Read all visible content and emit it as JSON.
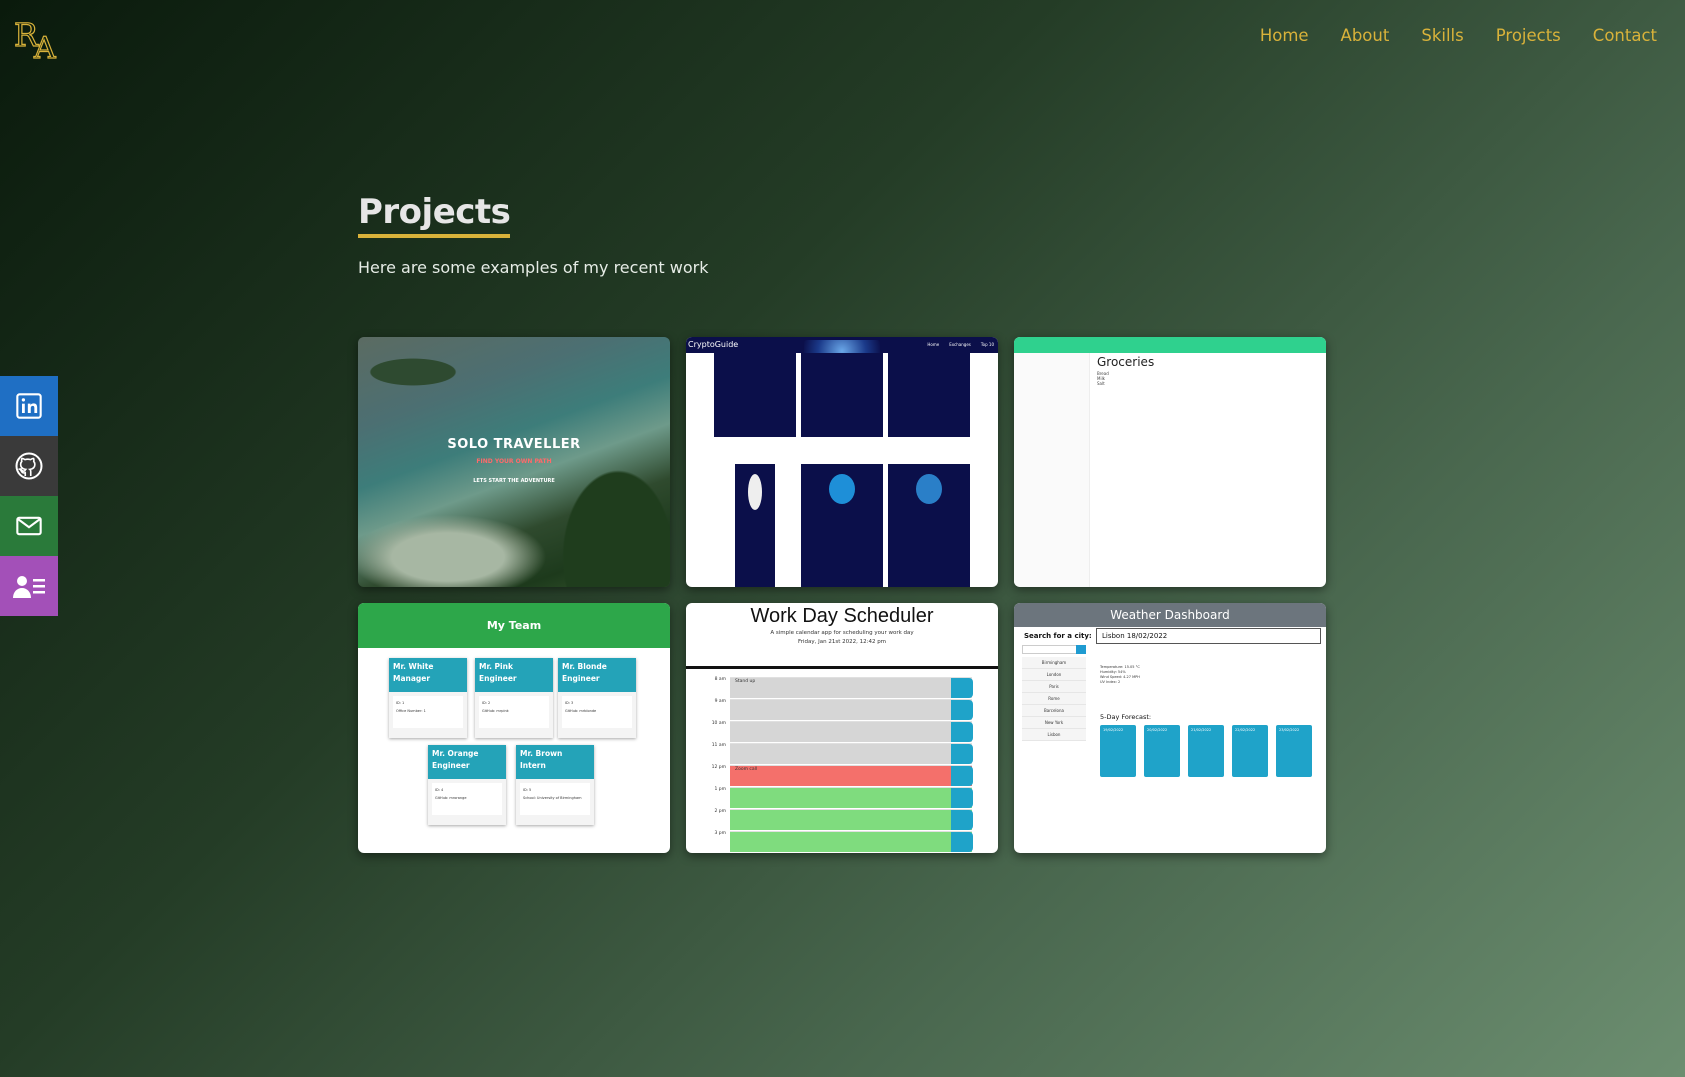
{
  "logo": {
    "text": "RA",
    "color": "#d9b23a"
  },
  "nav": {
    "items": [
      "Home",
      "About",
      "Skills",
      "Projects",
      "Contact"
    ],
    "color": "#d9b23a"
  },
  "social": [
    {
      "icon": "linkedin-icon",
      "color": "#1f6fc4"
    },
    {
      "icon": "github-icon",
      "color": "#3a3a3a"
    },
    {
      "icon": "mail-icon",
      "color": "#2a7a3a"
    },
    {
      "icon": "resume-icon",
      "color": "#a350b8"
    }
  ],
  "page": {
    "title": "Projects",
    "subtitle": "Here are some examples of my recent work"
  },
  "projects": {
    "solo": {
      "title": "SOLO TRAVELLER",
      "tagline": "FIND YOUR OWN PATH",
      "cta": "LETS START THE ADVENTURE"
    },
    "crypto": {
      "brand": "CryptoGuide",
      "nav": [
        "Home",
        "Exchanges",
        "Top 10"
      ]
    },
    "groceries": {
      "title": "Groceries",
      "items": [
        "Bread",
        "Milk",
        "Salt"
      ]
    },
    "team": {
      "title": "My Team",
      "members": [
        {
          "name": "Mr. White",
          "role": "Manager",
          "id": "ID: 1",
          "line": "Office Number: 1"
        },
        {
          "name": "Mr. Pink",
          "role": "Engineer",
          "id": "ID: 2",
          "line": "GitHub: mrpink"
        },
        {
          "name": "Mr. Blonde",
          "role": "Engineer",
          "id": "ID: 3",
          "line": "GitHub: mrblonde"
        },
        {
          "name": "Mr. Orange",
          "role": "Engineer",
          "id": "ID: 4",
          "line": "GitHub: mrorange"
        },
        {
          "name": "Mr. Brown",
          "role": "Intern",
          "id": "ID: 5",
          "line": "School: University of Birmingham"
        }
      ]
    },
    "scheduler": {
      "title": "Work Day Scheduler",
      "subtitle": "A simple calendar app for scheduling your work day",
      "date": "Friday, Jan 21st 2022, 12:42 pm",
      "hours": [
        "8 am",
        "9 am",
        "10 am",
        "11 am",
        "12 pm",
        "1 pm",
        "2 pm",
        "3 pm"
      ],
      "events": {
        "e1": "Stand up",
        "e2": "Zoom call"
      }
    },
    "weather": {
      "title": "Weather Dashboard",
      "search_label": "Search for a city:",
      "search_value": "Lisbon",
      "cities": [
        "Birmingham",
        "London",
        "Paris",
        "Rome",
        "Barcelona",
        "New York",
        "Lisbon"
      ],
      "current": "Lisbon 18/02/2022",
      "details": [
        "Temperature: 15.05 °C",
        "Humidity: 54%",
        "Wind Speed: 4.27 MPH",
        "UV Index: 2"
      ],
      "forecast_label": "5-Day Forecast:",
      "forecast_dates": [
        "19/02/2022",
        "20/02/2022",
        "21/02/2022",
        "22/02/2022",
        "23/02/2022"
      ]
    }
  }
}
